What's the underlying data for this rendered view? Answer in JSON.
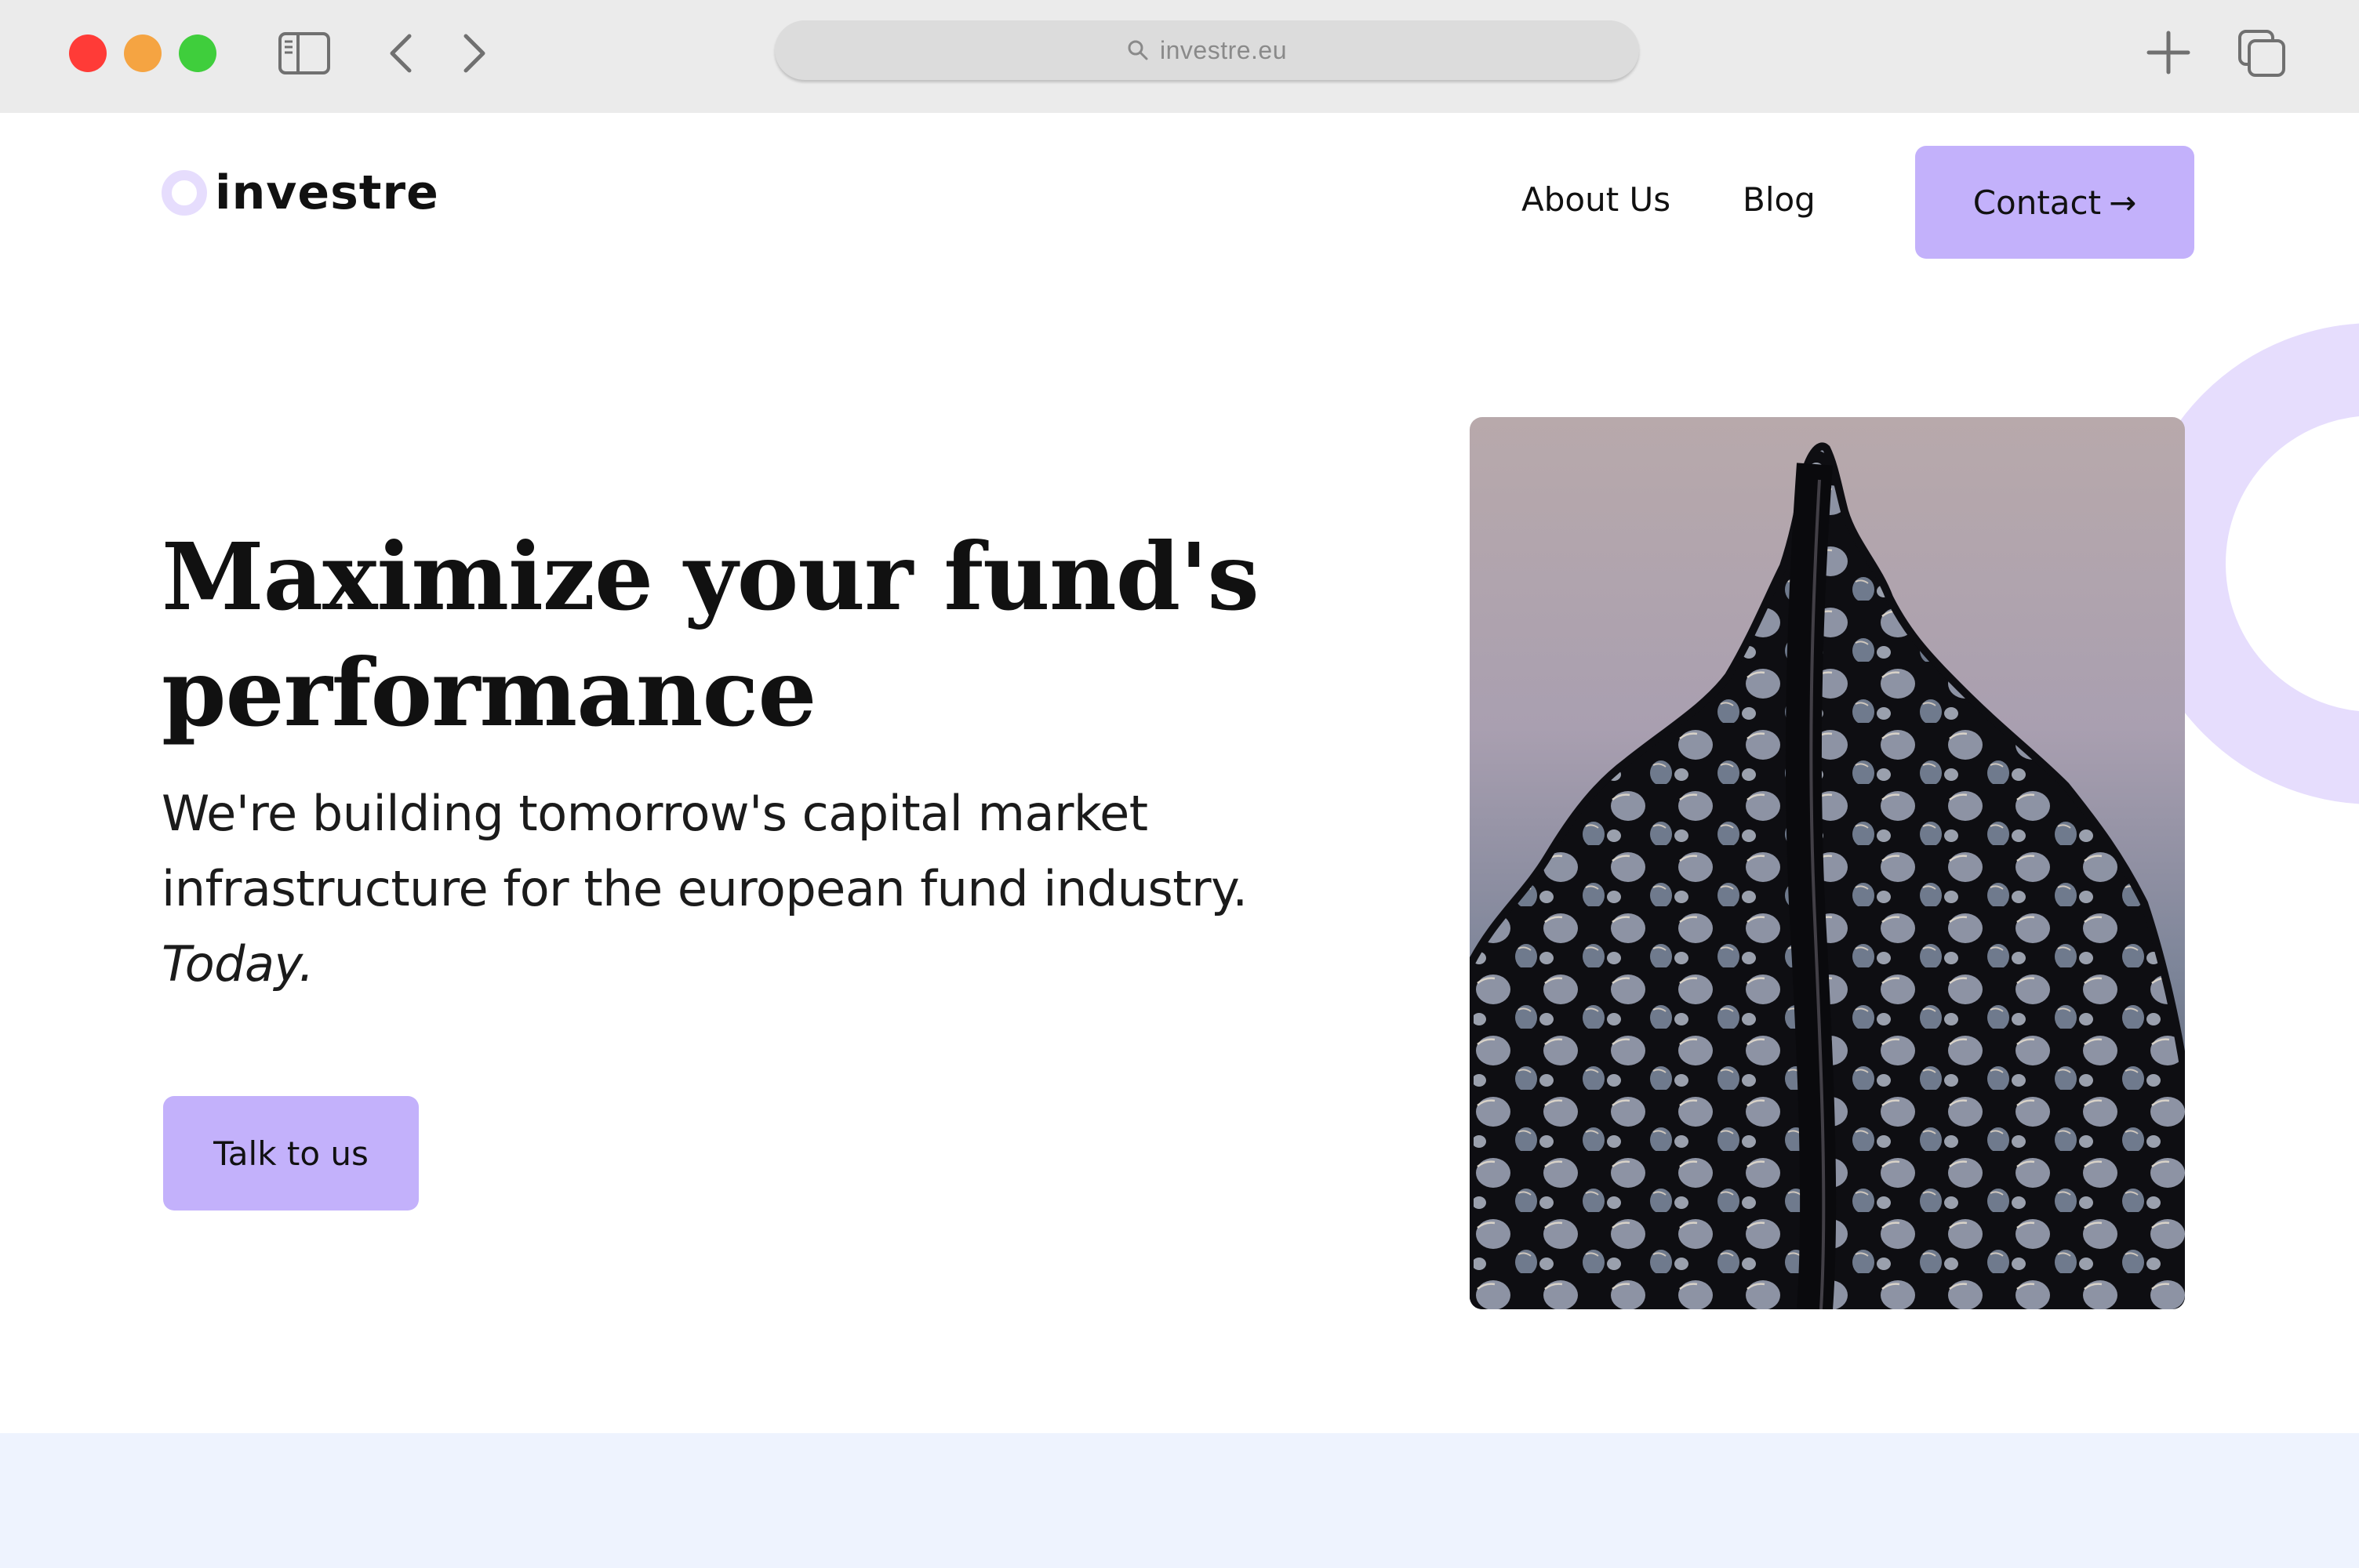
{
  "browser": {
    "url": "investre.eu",
    "icons": [
      "close-window-button",
      "minimize-window-button",
      "maximize-window-button",
      "sidebar-toggle-icon",
      "chevron-left-icon",
      "chevron-right-icon",
      "search-icon",
      "plus-icon",
      "tabs-overview-icon"
    ]
  },
  "header": {
    "logo_text": "investre",
    "nav": [
      {
        "label": "About Us"
      },
      {
        "label": "Blog"
      }
    ],
    "contact_label": "Contact",
    "contact_arrow": "→"
  },
  "hero": {
    "title": "Maximize your fund's performance",
    "subtitle": "We're building tomorrow's capital market infrastructure for the european fund industry.",
    "emphasis": "Today.",
    "cta_label": "Talk to us"
  },
  "colors": {
    "accent": "#c3b1fb",
    "accent_light": "#e6ddfd",
    "chrome_bg": "#ebebeb",
    "band_bg": "#eef3fe"
  }
}
